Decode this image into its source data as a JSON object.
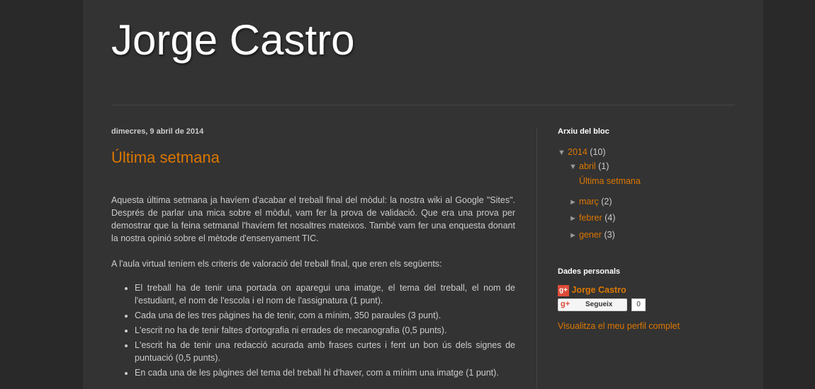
{
  "header": {
    "title": "Jorge Castro"
  },
  "post": {
    "date": "dimecres, 9 abril de 2014",
    "title": "Última setmana",
    "paragraphs": [
      "Aquesta última setmana ja havíem d'acabar el treball final del mòdul: la nostra wiki al Google \"Sites\". Després de parlar una mica sobre el mòdul, vam fer la prova de validació. Que era una prova per demostrar que la feina setmanal l'havíem fet nosaltres mateixos. També vam fer una enquesta donant la nostra opinió sobre el mètode d'ensenyament TIC.",
      "A l'aula virtual teníem els criteris de valoració del treball final, que eren els següents:"
    ],
    "criteria": [
      "El treball ha de tenir una portada on aparegui una imatge, el tema del treball, el nom de l'estudiant, el nom de l'escola i el nom de l'assignatura (1 punt).",
      "Cada una de les tres pàgines ha de tenir, com a mínim, 350 paraules (3 punt).",
      "L'escrit no ha de tenir faltes d'ortografia ni errades de mecanografia (0,5 punts).",
      "L'escrit ha de tenir una redacció acurada amb frases curtes i fent un bon ús dels signes de puntuació (0,5 punts).",
      "En cada una de les pàgines del tema del treball hi d'haver, com a mínim una imatge (1 punt)."
    ]
  },
  "sidebar": {
    "archive": {
      "title": "Arxiu del bloc",
      "year": {
        "label": "2014",
        "count": "(10)"
      },
      "months": [
        {
          "label": "abril",
          "count": "(1)",
          "expanded": true,
          "posts": [
            "Última setmana"
          ]
        },
        {
          "label": "març",
          "count": "(2)",
          "expanded": false
        },
        {
          "label": "febrer",
          "count": "(4)",
          "expanded": false
        },
        {
          "label": "gener",
          "count": "(3)",
          "expanded": false
        }
      ]
    },
    "profile": {
      "title": "Dades personals",
      "name": "Jorge Castro",
      "follow_label": "Segueix",
      "follow_count": "0",
      "profile_link": "Visualitza el meu perfil complet"
    }
  },
  "icons": {
    "expanded": "▼",
    "collapsed": "►",
    "google_plus": "g+"
  },
  "colors": {
    "link": "#dd7700",
    "background": "#292929",
    "content": "#333333"
  }
}
